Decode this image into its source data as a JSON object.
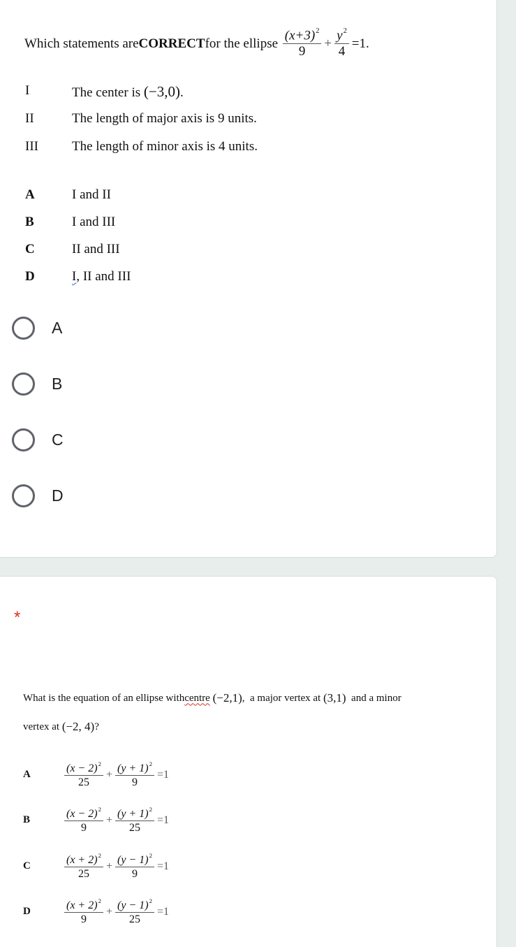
{
  "question1": {
    "prompt_prefix": "Which statements are ",
    "prompt_bold": "CORRECT",
    "prompt_suffix": " for the ellipse",
    "equation": {
      "term1_num": "(x+3)",
      "term1_exp": "2",
      "term1_den": "9",
      "plus": "+",
      "term2_num": "y",
      "term2_exp": "2",
      "term2_den": "4",
      "rhs": "=1."
    },
    "statements": [
      {
        "numeral": "I",
        "text": "The center is ",
        "math": "(−3,0)",
        "end": "."
      },
      {
        "numeral": "II",
        "text": "The length of major axis is 9 units.",
        "math": "",
        "end": ""
      },
      {
        "numeral": "III",
        "text": "The length of minor axis is 4 units.",
        "math": "",
        "end": ""
      }
    ],
    "options": [
      {
        "letter": "A",
        "text": "I and II"
      },
      {
        "letter": "B",
        "text": "I and III"
      },
      {
        "letter": "C",
        "text": "II and III"
      },
      {
        "letter": "D",
        "text_first": "I",
        "text_rest": ", II and III"
      }
    ],
    "choices": [
      {
        "label": "A",
        "selected": false
      },
      {
        "label": "B",
        "selected": false
      },
      {
        "label": "C",
        "selected": false
      },
      {
        "label": "D",
        "selected": false
      }
    ]
  },
  "question2": {
    "required_marker": "*",
    "prompt_line1_a": "What is the equation of an ellipse with ",
    "prompt_line1_centre": "centre",
    "prompt_line1_math1": "(−2,1)",
    "prompt_line1_b": ",  a major vertex at ",
    "prompt_line1_math2": "(3,1)",
    "prompt_line1_c": "  and a minor",
    "prompt_line2_a": "vertex at ",
    "prompt_line2_math": "(−2, 4)",
    "prompt_line2_b": " ?",
    "options": [
      {
        "letter": "A",
        "num1": "(x − 2)",
        "den1": "25",
        "num2": "(y + 1)",
        "den2": "9",
        "exp": "2",
        "plus": "+",
        "rhs": "=1"
      },
      {
        "letter": "B",
        "num1": "(x − 2)",
        "den1": "9",
        "num2": "(y + 1)",
        "den2": "25",
        "exp": "2",
        "plus": "+",
        "rhs": "=1"
      },
      {
        "letter": "C",
        "num1": "(x + 2)",
        "den1": "25",
        "num2": "(y − 1)",
        "den2": "9",
        "exp": "2",
        "plus": "+",
        "rhs": "=1"
      },
      {
        "letter": "D",
        "num1": "(x + 2)",
        "den1": "9",
        "num2": "(y − 1)",
        "den2": "25",
        "exp": "2",
        "plus": "+",
        "rhs": "=1"
      }
    ]
  }
}
